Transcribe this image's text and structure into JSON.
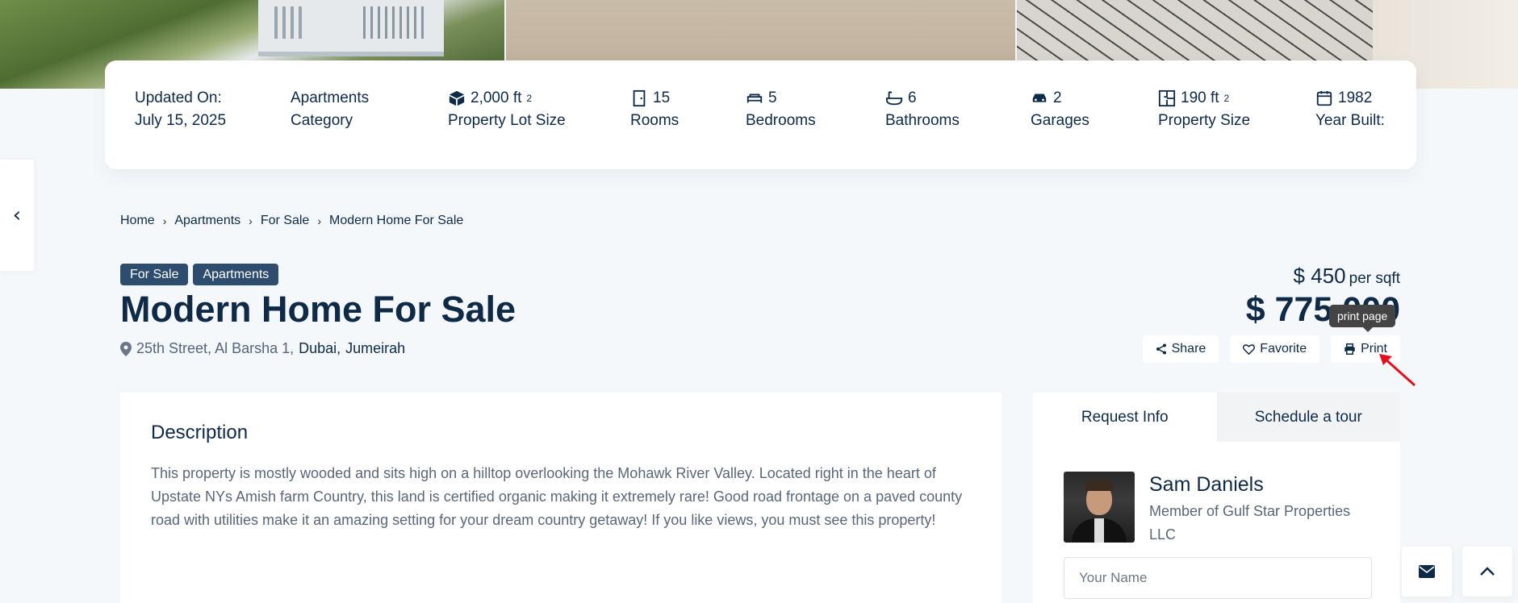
{
  "stats": [
    {
      "value": "Updated On:",
      "label": "July 15, 2025",
      "icon": ""
    },
    {
      "value": "Apartments",
      "label": "Category",
      "icon": ""
    },
    {
      "value": "2,000 ft",
      "sup": "2",
      "label": "Property Lot Size",
      "icon": "cube-icon"
    },
    {
      "value": "15",
      "label": "Rooms",
      "icon": "door-icon"
    },
    {
      "value": "5",
      "label": "Bedrooms",
      "icon": "bed-icon"
    },
    {
      "value": "6",
      "label": "Bathrooms",
      "icon": "bathtub-icon"
    },
    {
      "value": "2",
      "label": "Garages",
      "icon": "car-icon"
    },
    {
      "value": "190 ft",
      "sup": "2",
      "label": "Property Size",
      "icon": "floorplan-icon"
    },
    {
      "value": "1982",
      "label": "Year Built:",
      "icon": "calendar-icon"
    }
  ],
  "breadcrumb": [
    "Home",
    "Apartments",
    "For Sale",
    "Modern Home For Sale"
  ],
  "tags": [
    "For Sale",
    "Apartments"
  ],
  "property": {
    "title": "Modern Home For Sale",
    "address_street": "25th Street, Al Barsha 1,",
    "address_city": "Dubai,",
    "address_area": "Jumeirah",
    "price_sqft": "$ 450",
    "price_sqft_unit": "per sqft",
    "price": "$ 775,000"
  },
  "actions": {
    "share": "Share",
    "favorite": "Favorite",
    "print": "Print",
    "print_tooltip": "print page"
  },
  "description": {
    "heading": "Description",
    "text": "This property is mostly wooded and sits high on a hilltop overlooking the Mohawk River Valley. Located right in the heart of Upstate NYs Amish farm Country, this land is certified organic making it extremely rare! Good road frontage on a paved county road with utilities make it an amazing setting for your dream country getaway! If you like views, you must see this property!"
  },
  "contact": {
    "tabs": [
      "Request Info",
      "Schedule a tour"
    ],
    "agent_name": "Sam Daniels",
    "agent_org": "Member of Gulf Star Properties LLC",
    "name_placeholder": "Your Name"
  },
  "colors": {
    "accent": "#2e4d6e",
    "text": "#0f2a47",
    "background": "#f5f8fb",
    "annotation_arrow": "#e0101e"
  }
}
